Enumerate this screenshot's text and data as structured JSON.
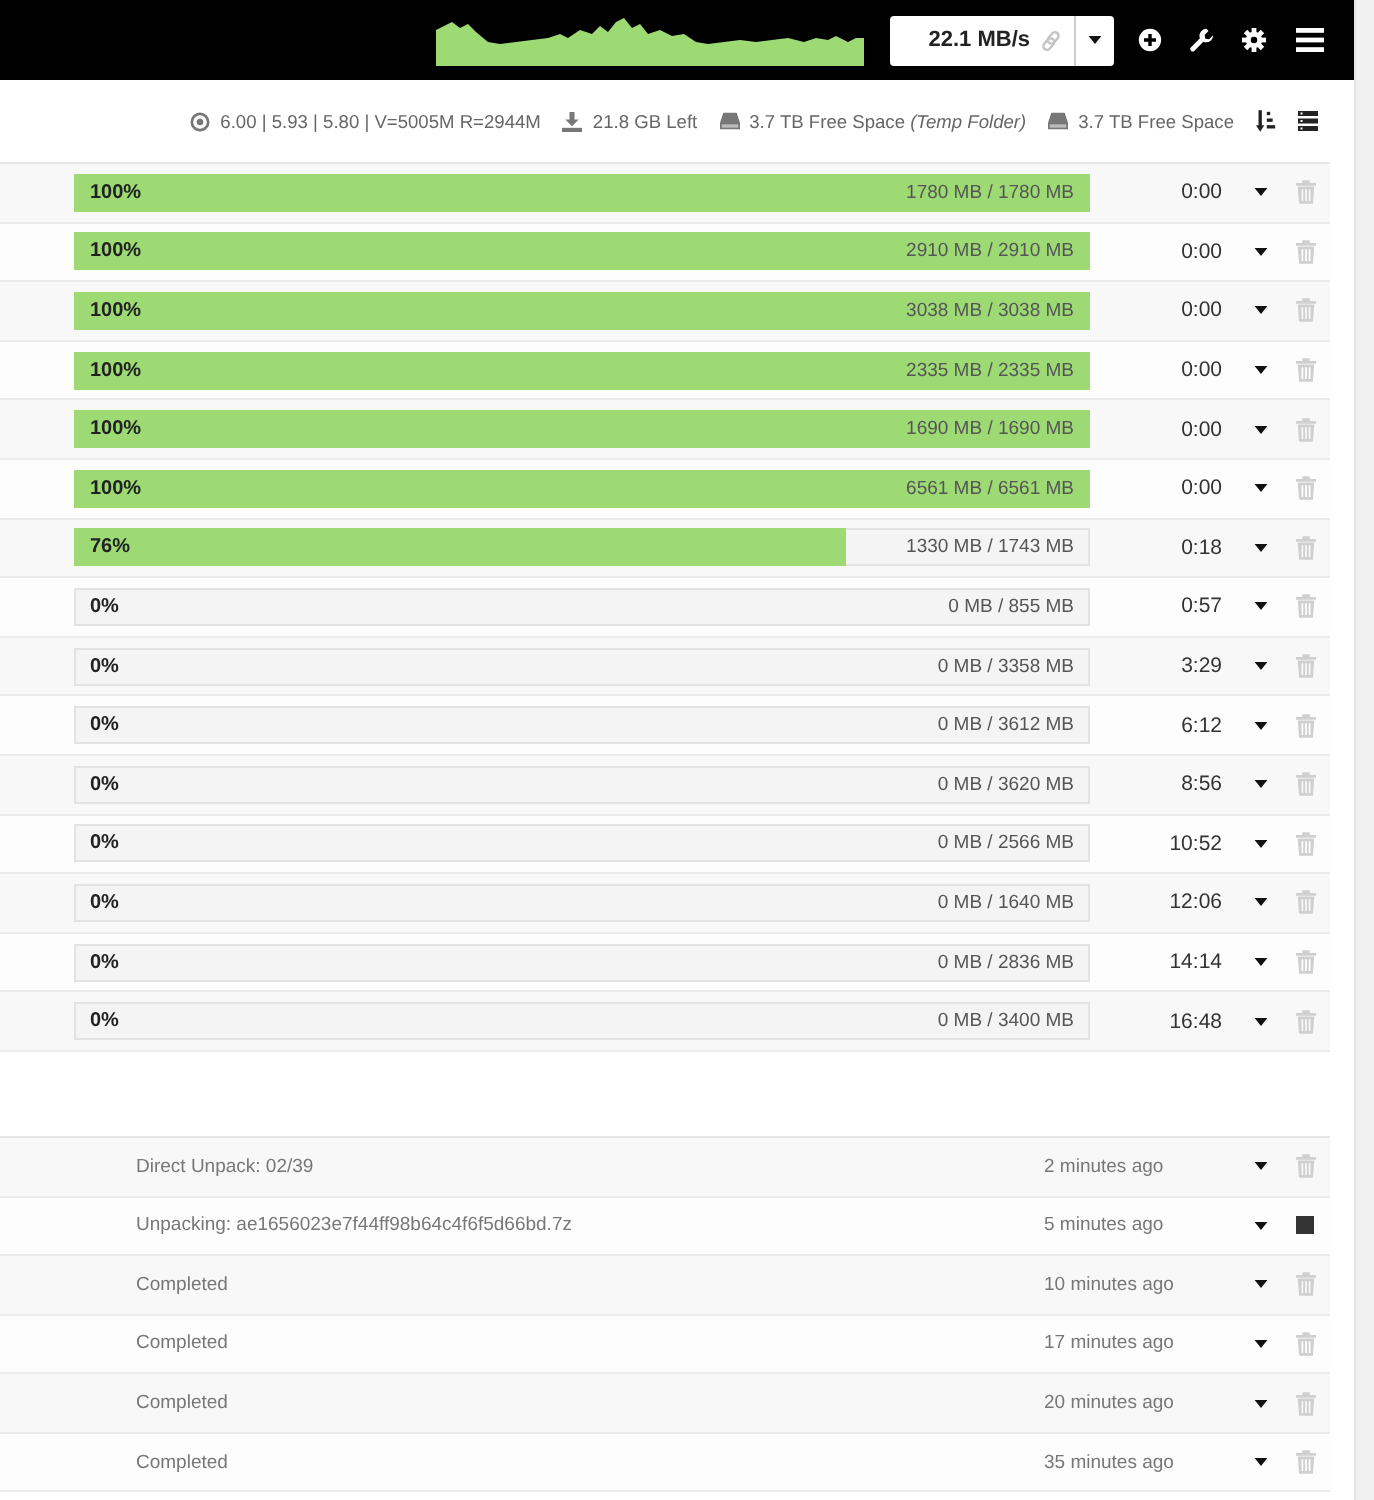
{
  "top_bar": {
    "speed": "22.1 MB/s"
  },
  "status_line": {
    "load": "6.00 | 5.93 | 5.80 | V=5005M R=2944M",
    "disk_left": "21.8 GB Left",
    "temp_folder_space": "3.7 TB Free Space *(Temp Folder)*",
    "complete_folder_space": "3.7 TB Free Space"
  },
  "queue": [
    {
      "percent": "100%",
      "level": 1,
      "size": "1780 MB / 1780 MB",
      "time_left": "0:00"
    },
    {
      "percent": "100%",
      "level": 1,
      "size": "2910 MB / 2910 MB",
      "time_left": "0:00"
    },
    {
      "percent": "100%",
      "level": 1,
      "size": "3038 MB / 3038 MB",
      "time_left": "0:00"
    },
    {
      "percent": "100%",
      "level": 1,
      "size": "2335 MB / 2335 MB",
      "time_left": "0:00"
    },
    {
      "percent": "100%",
      "level": 1,
      "size": "1690 MB / 1690 MB",
      "time_left": "0:00"
    },
    {
      "percent": "100%",
      "level": 1,
      "size": "6561 MB / 6561 MB",
      "time_left": "0:00"
    },
    {
      "percent": "76%",
      "level": 0.76,
      "size": "1330 MB / 1743 MB",
      "time_left": "0:18"
    },
    {
      "percent": "0%",
      "level": 0,
      "size": "0 MB / 855 MB",
      "time_left": "0:57"
    },
    {
      "percent": "0%",
      "level": 0,
      "size": "0 MB / 3358 MB",
      "time_left": "3:29"
    },
    {
      "percent": "0%",
      "level": 0,
      "size": "0 MB / 3612 MB",
      "time_left": "6:12"
    },
    {
      "percent": "0%",
      "level": 0,
      "size": "0 MB / 3620 MB",
      "time_left": "8:56"
    },
    {
      "percent": "0%",
      "level": 0,
      "size": "0 MB / 2566 MB",
      "time_left": "10:52"
    },
    {
      "percent": "0%",
      "level": 0,
      "size": "0 MB / 1640 MB",
      "time_left": "12:06"
    },
    {
      "percent": "0%",
      "level": 0,
      "size": "0 MB / 2836 MB",
      "time_left": "14:14"
    },
    {
      "percent": "0%",
      "level": 0,
      "size": "0 MB / 3400 MB",
      "time_left": "16:48"
    }
  ],
  "history": [
    {
      "status": "Direct Unpack: 02/39",
      "time": "2 minutes ago",
      "kind": "trash"
    },
    {
      "status": "Unpacking: ae1656023e7f44ff98b64c4f6f5d66bd.7z",
      "time": "5 minutes ago",
      "kind": "stop"
    },
    {
      "status": "Completed",
      "time": "10 minutes ago",
      "kind": "trash"
    },
    {
      "status": "Completed",
      "time": "17 minutes ago",
      "kind": "trash"
    },
    {
      "status": "Completed",
      "time": "20 minutes ago",
      "kind": "trash"
    },
    {
      "status": "Completed",
      "time": "35 minutes ago",
      "kind": "trash"
    }
  ]
}
